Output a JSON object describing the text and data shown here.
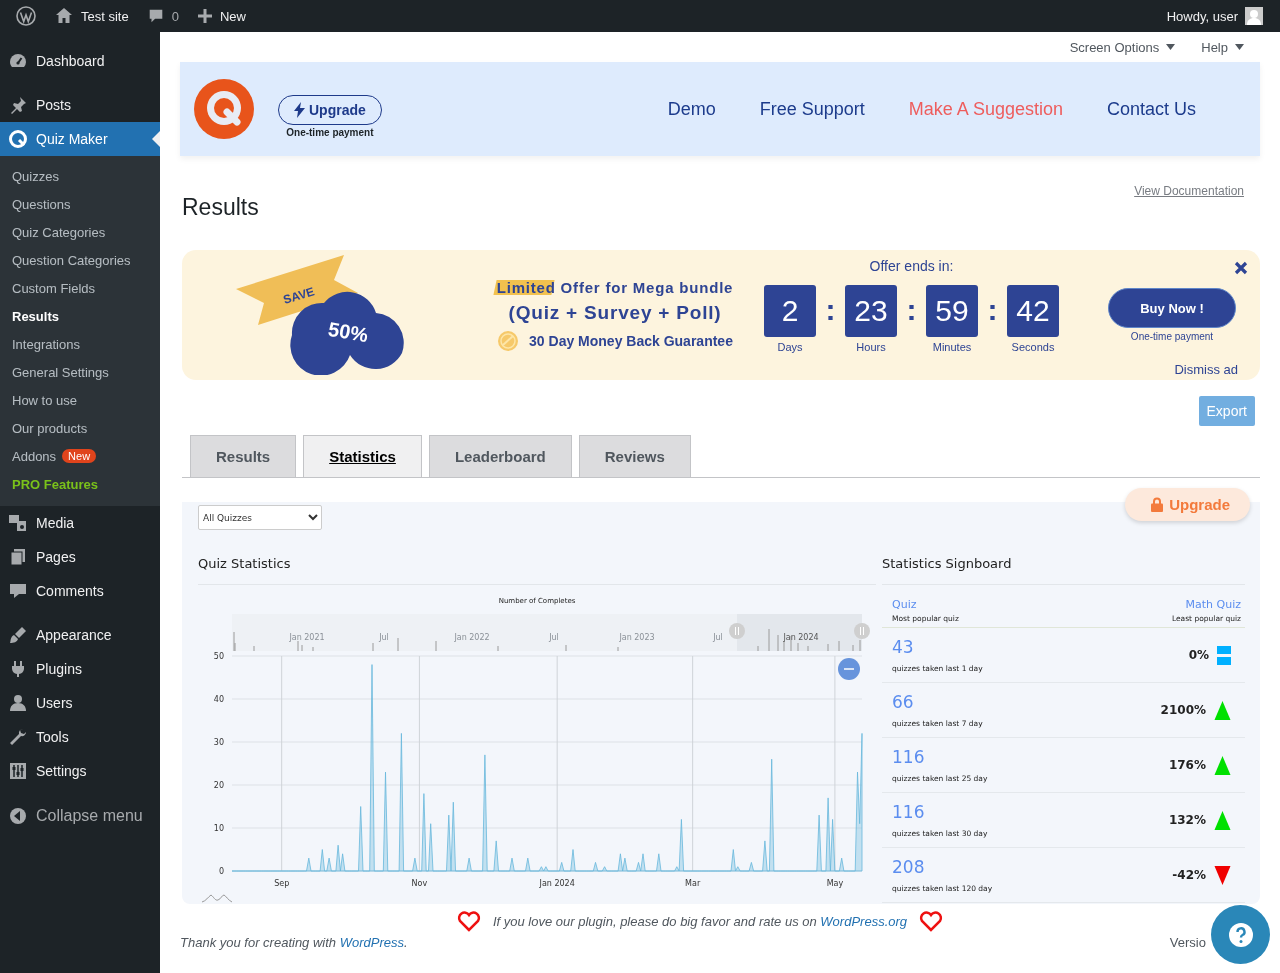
{
  "admin_bar": {
    "site": "Test site",
    "comments": "0",
    "new": "New",
    "greeting": "Howdy, user"
  },
  "sidebar": {
    "items": [
      {
        "label": "Dashboard",
        "selected": false
      },
      {
        "label": "Posts",
        "selected": false
      },
      {
        "label": "Quiz Maker",
        "selected": true,
        "children": [
          {
            "label": "Quizzes",
            "kind": "link",
            "selected": false
          },
          {
            "label": "Questions",
            "kind": "link",
            "selected": false
          },
          {
            "label": "Quiz Categories",
            "kind": "link",
            "selected": false
          },
          {
            "label": "Question Categories",
            "kind": "link",
            "selected": false
          },
          {
            "label": "Custom Fields",
            "kind": "link",
            "selected": false
          },
          {
            "label": "Results",
            "kind": "link",
            "selected": true
          },
          {
            "label": "Integrations",
            "kind": "link",
            "selected": false
          },
          {
            "label": "General Settings",
            "kind": "link",
            "selected": false
          },
          {
            "label": "How to use",
            "kind": "link",
            "selected": false
          },
          {
            "label": "Our products",
            "kind": "link",
            "selected": false
          },
          {
            "label": "Addons",
            "kind": "link",
            "selected": false,
            "badge": "New"
          },
          {
            "label": "PRO Features",
            "kind": "pro",
            "selected": false
          }
        ]
      },
      {
        "label": "Media",
        "selected": false
      },
      {
        "label": "Pages",
        "selected": false
      },
      {
        "label": "Comments",
        "selected": false
      },
      {
        "label": "Appearance",
        "selected": false
      },
      {
        "label": "Plugins",
        "selected": false
      },
      {
        "label": "Users",
        "selected": false
      },
      {
        "label": "Tools",
        "selected": false
      },
      {
        "label": "Settings",
        "selected": false
      }
    ],
    "collapse": "Collapse menu"
  },
  "screen_meta": {
    "screen_options": "Screen Options",
    "help": "Help"
  },
  "header": {
    "upgrade": "Upgrade",
    "upgrade_note": "One-time payment",
    "links": [
      {
        "label": "Demo",
        "highlighted": false
      },
      {
        "label": "Free Support",
        "highlighted": false
      },
      {
        "label": "Make A Suggestion",
        "highlighted": true
      },
      {
        "label": "Contact Us",
        "highlighted": false
      }
    ]
  },
  "page": {
    "title": "Results",
    "documentation": "View Documentation"
  },
  "ad": {
    "save": "SAVE",
    "discount": "50%",
    "headline": "Limited Offer for Mega bundle",
    "bundle": "(Quiz + Survey + Poll)",
    "guarantee": "30 Day Money Back Guarantee",
    "offer_label": "Offer ends in:",
    "countdown": [
      {
        "value": "2",
        "unit": "Days"
      },
      {
        "separator": ":",
        "value": "23",
        "unit": "Hours"
      },
      {
        "separator": ":",
        "value": "59",
        "unit": "Minutes"
      },
      {
        "separator": ":",
        "value": "42",
        "unit": "Seconds"
      }
    ],
    "buy": "Buy Now !",
    "buy_note": "One-time payment",
    "dismiss": "Dismiss ad"
  },
  "export": "Export",
  "tabs": [
    {
      "label": "Results",
      "selected": false
    },
    {
      "label": "Statistics",
      "selected": true
    },
    {
      "label": "Leaderboard",
      "selected": false
    },
    {
      "label": "Reviews",
      "selected": false
    }
  ],
  "statistics": {
    "upgrade": "Upgrade",
    "filter": "All Quizzes",
    "title": "Quiz Statistics",
    "navigator": {
      "labels": [
        "Jan 2021",
        "Jul",
        "Jan 2022",
        "Jul",
        "Jan 2023",
        "Jul",
        "Jan 2024"
      ]
    },
    "chart_data": {
      "type": "area",
      "title": "Number of Completes",
      "categories": [
        null,
        null,
        null,
        null,
        null,
        null,
        null,
        null,
        null,
        null,
        null,
        null,
        null,
        null,
        null,
        null,
        null,
        null,
        null,
        null,
        null,
        null,
        "Sep",
        null,
        null,
        null,
        null,
        null,
        null,
        null,
        null,
        null,
        null,
        null,
        null,
        null,
        null,
        null,
        null,
        null,
        null,
        null,
        null,
        null,
        null,
        null,
        null,
        null,
        null,
        null,
        null,
        null,
        null,
        null,
        null,
        null,
        null,
        null,
        null,
        null,
        null,
        null,
        null,
        null,
        null,
        null,
        null,
        null,
        null,
        null,
        null,
        null,
        null,
        null,
        null,
        null,
        null,
        null,
        null,
        null,
        null,
        null,
        null,
        "Nov",
        null,
        null,
        null,
        null,
        null,
        null,
        null,
        null,
        null,
        null,
        null,
        null,
        null,
        null,
        null,
        null,
        null,
        null,
        null,
        null,
        null,
        null,
        null,
        null,
        null,
        null,
        null,
        null,
        null,
        null,
        null,
        null,
        null,
        null,
        null,
        null,
        null,
        null,
        null,
        null,
        null,
        null,
        null,
        null,
        null,
        null,
        null,
        null,
        null,
        null,
        null,
        null,
        null,
        null,
        null,
        null,
        null,
        null,
        null,
        null,
        "Jan 2024",
        null,
        null,
        null,
        null,
        null,
        null,
        null,
        null,
        null,
        null,
        null,
        null,
        null,
        null,
        null,
        null,
        null,
        null,
        null,
        null,
        null,
        null,
        null,
        null,
        null,
        null,
        null,
        null,
        null,
        null,
        null,
        null,
        null,
        null,
        null,
        null,
        null,
        null,
        null,
        null,
        null,
        null,
        null,
        null,
        null,
        null,
        null,
        null,
        null,
        null,
        null,
        null,
        null,
        null,
        null,
        null,
        null,
        null,
        null,
        "Mar",
        null,
        null,
        null,
        null,
        null,
        null,
        null,
        null,
        null,
        null,
        null,
        null,
        null,
        null,
        null,
        null,
        null,
        null,
        null,
        null,
        null,
        null,
        null,
        null,
        null,
        null,
        null,
        null,
        null,
        null,
        null,
        null,
        null,
        null,
        null,
        null,
        null,
        null,
        null,
        null,
        null,
        null,
        null,
        null,
        null,
        null,
        null,
        null,
        null,
        null,
        null,
        null,
        null,
        null,
        null,
        null,
        null,
        null,
        null,
        null,
        null,
        null,
        "May",
        null,
        null,
        null,
        null,
        null,
        null,
        null,
        null,
        null,
        null,
        null,
        null
      ],
      "series": [
        {
          "color": "#67b7dc",
          "values": [
            0,
            0,
            0,
            0,
            0,
            0,
            0,
            0,
            0,
            0,
            0,
            0,
            0,
            0,
            0,
            0,
            0,
            0,
            0,
            0,
            0,
            0,
            0,
            0,
            0,
            0,
            0,
            0,
            0,
            0,
            0,
            0,
            0,
            0,
            3,
            0,
            0,
            0,
            0,
            0,
            5,
            0,
            0,
            3,
            0,
            0,
            0,
            6,
            0,
            4,
            0,
            0,
            0,
            0,
            0,
            0,
            0,
            15,
            0,
            0,
            0,
            0,
            48,
            0,
            0,
            0,
            0,
            0,
            23,
            0,
            0,
            0,
            0,
            0,
            0,
            32,
            0,
            0,
            0,
            0,
            0,
            3,
            0,
            0,
            0,
            18,
            0,
            0,
            11,
            0,
            0,
            0,
            0,
            0,
            0,
            0,
            13,
            0,
            16,
            0,
            0,
            0,
            0,
            0,
            0,
            3,
            0,
            0,
            0,
            0,
            0,
            0,
            27,
            0,
            0,
            0,
            0,
            7,
            0,
            0,
            0,
            0,
            0,
            0,
            3,
            0,
            0,
            0,
            0,
            0,
            0,
            3,
            0,
            0,
            0,
            0,
            0,
            1,
            0,
            1,
            0,
            0,
            0,
            0,
            0,
            0,
            2,
            0,
            0,
            0,
            0,
            5,
            0,
            0,
            0,
            0,
            0,
            0,
            0,
            0,
            0,
            2,
            0,
            0,
            0,
            1,
            0,
            0,
            0,
            0,
            0,
            0,
            4,
            0,
            3,
            0,
            0,
            0,
            0,
            0,
            2,
            0,
            4,
            0,
            0,
            0,
            0,
            0,
            0,
            4,
            0,
            0,
            0,
            0,
            0,
            0,
            0,
            1,
            0,
            12,
            0,
            0,
            0,
            0,
            0,
            0,
            0,
            0,
            0,
            0,
            0,
            0,
            0,
            0,
            0,
            0,
            0,
            0,
            0,
            0,
            0,
            0,
            5,
            0,
            1,
            0,
            0,
            0,
            0,
            0,
            2,
            0,
            0,
            0,
            0,
            0,
            7,
            0,
            0,
            26,
            0,
            0,
            0,
            0,
            0,
            0,
            0,
            0,
            0,
            0,
            0,
            0,
            0,
            0,
            0,
            0,
            0,
            0,
            0,
            0,
            13,
            0,
            0,
            0,
            17,
            0,
            12,
            0,
            0,
            0,
            3,
            0,
            0,
            0,
            0,
            0,
            0,
            23,
            11,
            32
          ]
        }
      ],
      "ylim": [
        0,
        50
      ],
      "yticks": [
        0,
        10,
        20,
        30,
        40,
        50
      ],
      "grid": true
    },
    "signboard": {
      "title": "Statistics Signboard",
      "most_popular": {
        "name": "Quiz",
        "caption": "Most popular quiz"
      },
      "least_popular": {
        "name": "Math Quiz",
        "caption": "Least popular quiz"
      },
      "rows": [
        {
          "count": "43",
          "caption": "quizzes taken last 1 day",
          "change": "0%",
          "kind": "flat"
        },
        {
          "count": "66",
          "caption": "quizzes taken last 7 day",
          "change": "2100%",
          "kind": "up"
        },
        {
          "count": "116",
          "caption": "quizzes taken last 25 day",
          "change": "176%",
          "kind": "up"
        },
        {
          "count": "116",
          "caption": "quizzes taken last 30 day",
          "change": "132%",
          "kind": "up"
        },
        {
          "count": "208",
          "caption": "quizzes taken last 120 day",
          "change": "-42%",
          "kind": "down"
        }
      ]
    }
  },
  "footer": {
    "rate_text": "If you love our plugin, please do big favor and rate us on ",
    "rate_link": "WordPress.org",
    "thanks_text": "Thank you for creating with ",
    "thanks_link": "WordPress",
    "thanks_end": ".",
    "version": "Versio"
  }
}
